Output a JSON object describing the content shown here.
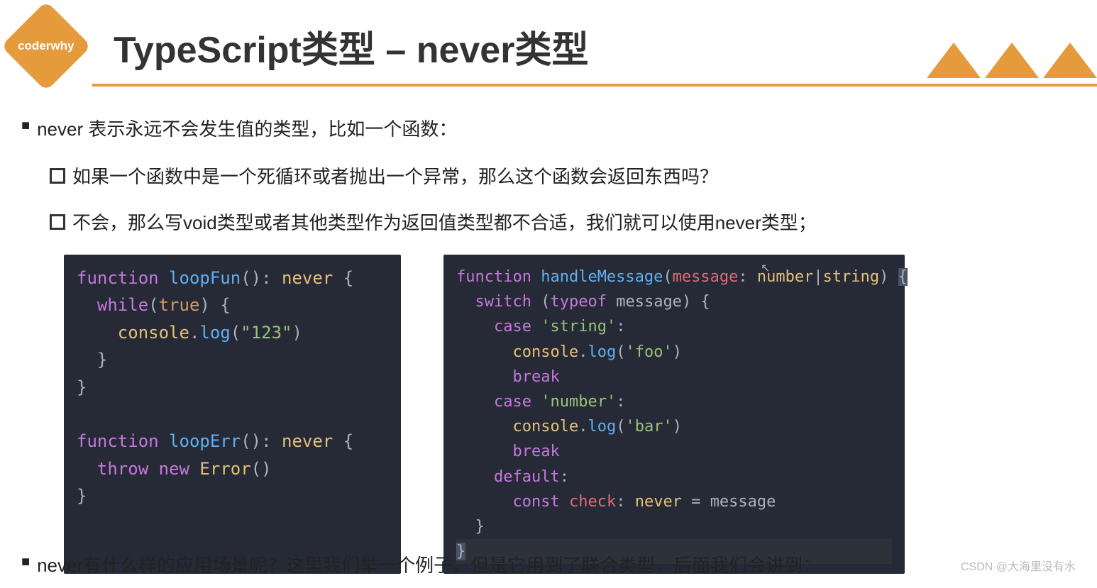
{
  "logo": "coderwhy",
  "title": "TypeScript类型 – never类型",
  "bullets": {
    "b1": "never 表示永远不会发生值的类型，比如一个函数：",
    "b2": "如果一个函数中是一个死循环或者抛出一个异常，那么这个函数会返回东西吗？",
    "b3": "不会，那么写void类型或者其他类型作为返回值类型都不合适，我们就可以使用never类型；",
    "b4": "never有什么样的应用场景呢？这里我们举一个例子，但是它用到了联合类型，后面我们会讲到："
  },
  "code1": {
    "l1_kw": "function",
    "l1_fn": "loopFun",
    "l1_p1": "(): ",
    "l1_type": "never",
    "l1_b": " {",
    "l2_kw": "while",
    "l2_p1": "(",
    "l2_bool": "true",
    "l2_p2": ") {",
    "l3_obj": "console",
    "l3_p1": ".",
    "l3_fn": "log",
    "l3_p2": "(",
    "l3_str": "\"123\"",
    "l3_p3": ")",
    "l4": "}",
    "l5": "}",
    "l6_kw": "function",
    "l6_fn": "loopErr",
    "l6_p1": "(): ",
    "l6_type": "never",
    "l6_b": " {",
    "l7_kw1": "throw",
    "l7_kw2": "new",
    "l7_cls": "Error",
    "l7_p": "()",
    "l8": "}"
  },
  "code2": {
    "l1_kw": "function",
    "l1_fn": "handleMessage",
    "l1_p1": "(",
    "l1_arg": "message",
    "l1_p2": ": ",
    "l1_t1": "number",
    "l1_pipe": "|",
    "l1_t2": "string",
    "l1_p3": ") ",
    "l1_b": "{",
    "l2_kw": "switch",
    "l2_p1": " (",
    "l2_op": "typeof",
    "l2_var": " message",
    "l2_p2": ") {",
    "l3_kw": "case",
    "l3_str": "'string'",
    "l3_p": ":",
    "l4_obj": "console",
    "l4_p1": ".",
    "l4_fn": "log",
    "l4_p2": "(",
    "l4_str": "'foo'",
    "l4_p3": ")",
    "l5_kw": "break",
    "l6_kw": "case",
    "l6_str": "'number'",
    "l6_p": ":",
    "l7_obj": "console",
    "l7_p1": ".",
    "l7_fn": "log",
    "l7_p2": "(",
    "l7_str": "'bar'",
    "l7_p3": ")",
    "l8_kw": "break",
    "l9_kw": "default",
    "l9_p": ":",
    "l10_kw": "const",
    "l10_var": "check",
    "l10_p1": ": ",
    "l10_type": "never",
    "l10_p2": " = ",
    "l10_val": "message",
    "l11": "}",
    "l12": "}"
  },
  "watermark": "CSDN @大海里没有水"
}
